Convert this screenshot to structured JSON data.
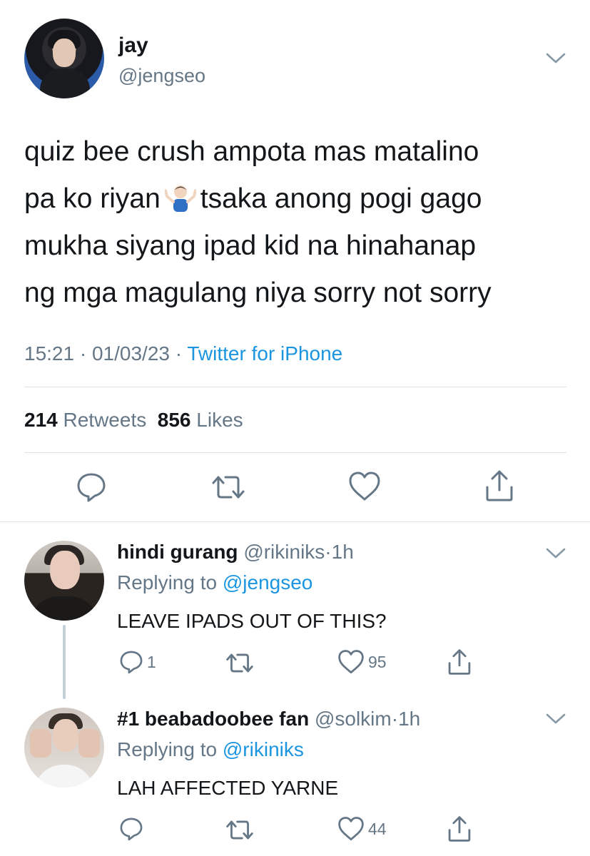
{
  "main_tweet": {
    "name": "jay",
    "handle": "@jengseo",
    "text_line1": "quiz bee crush ampota mas matalino",
    "text_line2a": "pa ko riyan",
    "text_line2b": "tsaka anong pogi gago",
    "text_line3": "mukha siyang ipad kid na hinahanap",
    "text_line4": "ng mga magulang niya sorry not sorry",
    "emoji": "person-shrugging-emoji",
    "time": "15:21",
    "sep1": "·",
    "date": "01/03/23",
    "sep2": "·",
    "source": "Twitter for iPhone",
    "retweets_count": "214",
    "retweets_label": "Retweets",
    "likes_count": "856",
    "likes_label": "Likes"
  },
  "replies": [
    {
      "name": "hindi gurang",
      "handle": "@rikiniks",
      "sep": "·",
      "time": "1h",
      "replying_prefix": "Replying to",
      "replying_to": "@jengseo",
      "text": "LEAVE IPADS OUT OF THIS?",
      "reply_count": "1",
      "like_count": "95"
    },
    {
      "name": "#1 beabadoobee fan",
      "handle": "@solkim",
      "sep": "·",
      "time": "1h",
      "replying_prefix": "Replying to",
      "replying_to": "@rikiniks",
      "text": "LAH AFFECTED YARNE",
      "like_count": "44"
    }
  ],
  "colors": {
    "link": "#1b95e0",
    "muted": "#657786",
    "text": "#14171a",
    "divider": "#dfe3e8"
  }
}
